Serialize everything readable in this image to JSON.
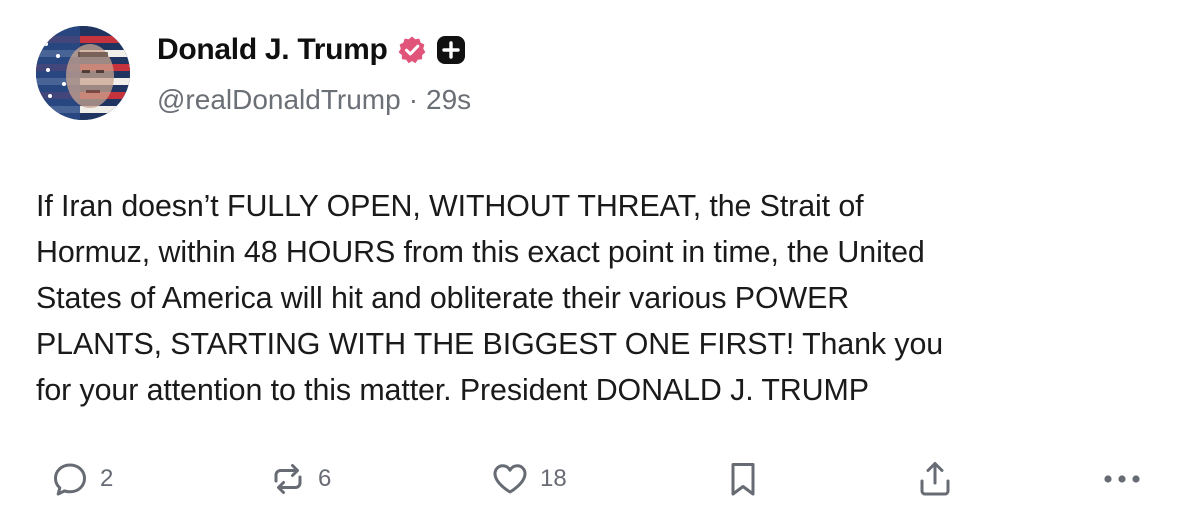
{
  "post": {
    "author": {
      "display_name": "Donald J. Trump",
      "handle": "@realDonaldTrump",
      "timestamp": "29s",
      "separator": "·",
      "verified_badge_color": "#e0547a",
      "verified_icon": "verified-check-icon",
      "plus_icon": "plus-badge-icon",
      "avatar": "avatar-flag-portrait"
    },
    "body": "If Iran doesn’t FULLY OPEN, WITHOUT THREAT, the Strait of\nHormuz, within 48 HOURS from this exact point in time, the United\nStates of America will hit and obliterate their various POWER\nPLANTS, STARTING WITH THE BIGGEST ONE FIRST! Thank you\nfor your attention to this matter. President DONALD J. TRUMP",
    "actions": {
      "reply": {
        "icon": "reply-bubble-icon",
        "count": "2"
      },
      "repost": {
        "icon": "repost-icon",
        "count": "6"
      },
      "like": {
        "icon": "heart-icon",
        "count": "18"
      },
      "bookmark": {
        "icon": "bookmark-icon"
      },
      "share": {
        "icon": "share-upload-icon"
      },
      "more": {
        "icon": "more-dots-icon"
      }
    },
    "icon_color": "#676b73"
  }
}
